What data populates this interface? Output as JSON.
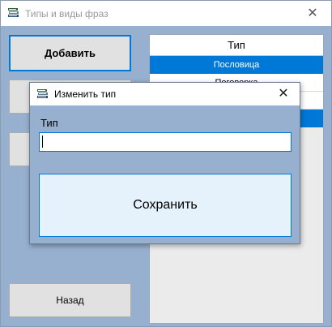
{
  "window": {
    "title": "Типы и виды фраз",
    "close_glyph": "✕",
    "icon": "books-icon"
  },
  "left_buttons": {
    "add_label": "Добавить",
    "back_label": "Назад"
  },
  "grid": {
    "column_header": "Тип",
    "rows": [
      {
        "label": "Пословица",
        "selected": true
      },
      {
        "label": "Поговорка",
        "selected": false
      },
      {
        "label": "",
        "selected": false
      },
      {
        "label": "",
        "selected": true
      }
    ]
  },
  "dialog": {
    "title": "Изменить тип",
    "close_glyph": "✕",
    "icon": "books-icon",
    "field_label": "Тип",
    "field_value": "",
    "save_label": "Сохранить"
  },
  "colors": {
    "client_bg": "#97b0cf",
    "selection": "#0078d7",
    "button_bg": "#e1e1e1",
    "save_bg": "#e5f1fb"
  }
}
